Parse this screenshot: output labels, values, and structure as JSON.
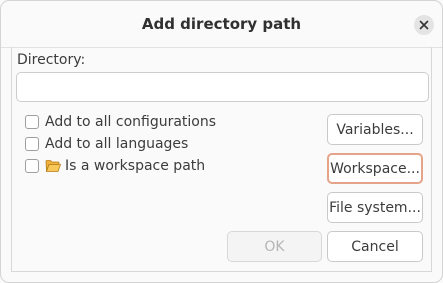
{
  "dialog": {
    "title": "Add directory path"
  },
  "form": {
    "directory_label": "Directory:",
    "directory_value": "",
    "directory_placeholder": ""
  },
  "options": {
    "all_configurations": "Add to all configurations",
    "all_languages": "Add to all languages",
    "workspace_path": "Is a workspace path"
  },
  "buttons": {
    "variables": "Variables...",
    "workspace": "Workspace...",
    "file_system": "File system...",
    "ok": "OK",
    "cancel": "Cancel"
  },
  "colors": {
    "focus_ring": "#e5a48a",
    "folder": "#f5a623"
  },
  "icons": {
    "close": "close-icon",
    "folder": "folder-open-icon"
  }
}
